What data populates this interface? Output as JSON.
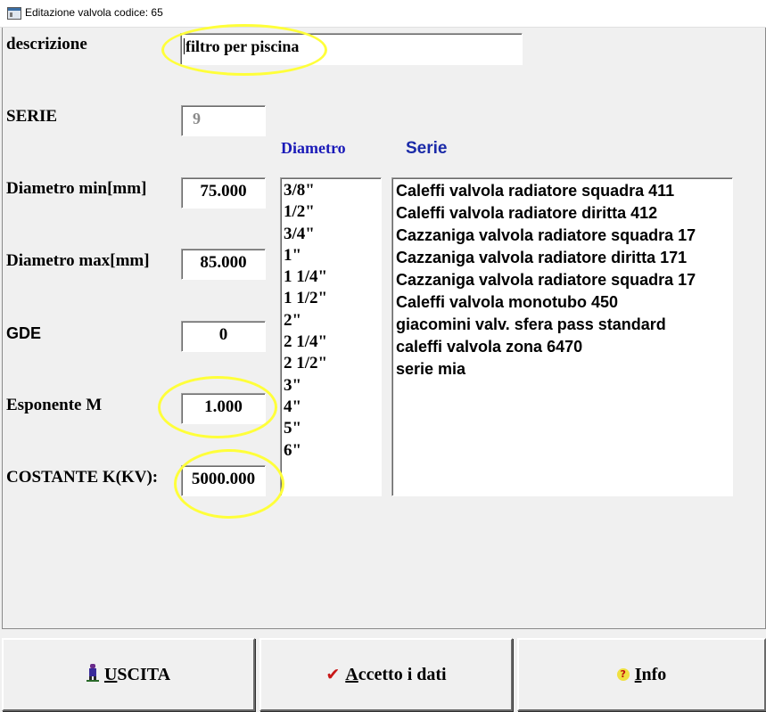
{
  "window": {
    "title": "Editazione valvola codice: 65",
    "icon": "window-app-icon"
  },
  "form": {
    "descrizione": {
      "label": "descrizione",
      "value": "filtro per piscina"
    },
    "serie": {
      "label": "SERIE",
      "value": "9"
    },
    "diametro_min": {
      "label": "Diametro min[mm]",
      "value": "75.000"
    },
    "diametro_max": {
      "label": "Diametro max[mm]",
      "value": "85.000"
    },
    "gde": {
      "label": "GDE",
      "value": "0"
    },
    "esponente_m": {
      "label": "Esponente M",
      "value": "1.000"
    },
    "costante_k": {
      "label": "COSTANTE K(KV):",
      "value": "5000.000"
    }
  },
  "diametro_list": {
    "header": "Diametro",
    "items": [
      "3/8\"",
      "1/2\"",
      "3/4\"",
      "1\"",
      "1 1/4\"",
      "1 1/2\"",
      "2\"",
      "2 1/4\"",
      "2 1/2\"",
      "3\"",
      "4\"",
      "5\"",
      "6\""
    ]
  },
  "serie_list": {
    "header": "Serie",
    "items": [
      "Caleffi valvola radiatore squadra 411",
      "Caleffi valvola radiatore diritta 412",
      "Cazzaniga valvola radiatore squadra 17",
      "Cazzaniga valvola radiatore diritta 171",
      "Cazzaniga valvola radiatore squadra 17",
      "Caleffi valvola monotubo 450",
      "giacomini valv. sfera  pass standard",
      "caleffi valvola zona 6470",
      "serie mia"
    ]
  },
  "buttons": {
    "uscita": {
      "label": "USCITA",
      "icon": "exit-person-icon"
    },
    "accetto": {
      "label": "Accetto i dati",
      "icon": "checkmark-icon"
    },
    "info": {
      "label": "Info",
      "icon": "help-icon"
    }
  },
  "colors": {
    "highlight": "#ffff3a",
    "column_header": "#1a1ab8",
    "check_icon": "#c81818"
  }
}
